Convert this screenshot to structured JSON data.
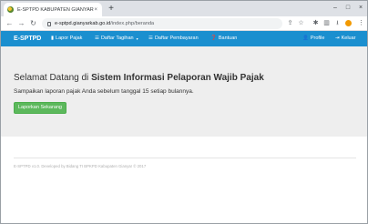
{
  "browser": {
    "tab_title": "E-SPTPD KABUPATEN GIANYAR",
    "tab_close": "×",
    "new_tab": "+",
    "win_min": "–",
    "win_max": "□",
    "win_close": "×",
    "url_host": "e-sptpd.gianyarkab.go.id",
    "url_path": "/index.php/beranda",
    "icons": [
      "back-icon",
      "forward-icon",
      "reload-icon",
      "lock-icon",
      "share-icon",
      "star-icon",
      "extensions-icon",
      "side-panel-icon",
      "profile-icon",
      "menu-icon"
    ]
  },
  "navbar": {
    "brand": "E-SPTPD",
    "items": [
      {
        "icon": "file-icon",
        "glyph": "▮",
        "label": "Lapor Pajak"
      },
      {
        "icon": "list-icon",
        "glyph": "☰",
        "label": "Daftar Tagihan",
        "caret": "▾"
      },
      {
        "icon": "list-icon",
        "glyph": "☰",
        "label": "Daftar Pembayaran"
      },
      {
        "icon": "help-icon",
        "glyph": "❓",
        "label": "Bantuan"
      }
    ],
    "profile_glyph": "👤",
    "profile": "Profile",
    "logout_glyph": "⇥",
    "logout": "Keluar"
  },
  "hero": {
    "title_prefix": "Selamat Datang di ",
    "title_strong": "Sistem Informasi Pelaporan Wajib Pajak",
    "subtitle": "Sampaikan laporan pajak Anda sebelum tanggal 15 setiap bulannya.",
    "button": "Laporkan Sekarang",
    "button_color": "#5cb85c"
  },
  "footer": {
    "text": "E-SPTPD v1.0. Developed by Bidang TI BPKPD Kabupaten Gianyar © 2017"
  },
  "colors": {
    "navbar": "#1b8fcf",
    "hero_bg": "#eeeeee"
  }
}
